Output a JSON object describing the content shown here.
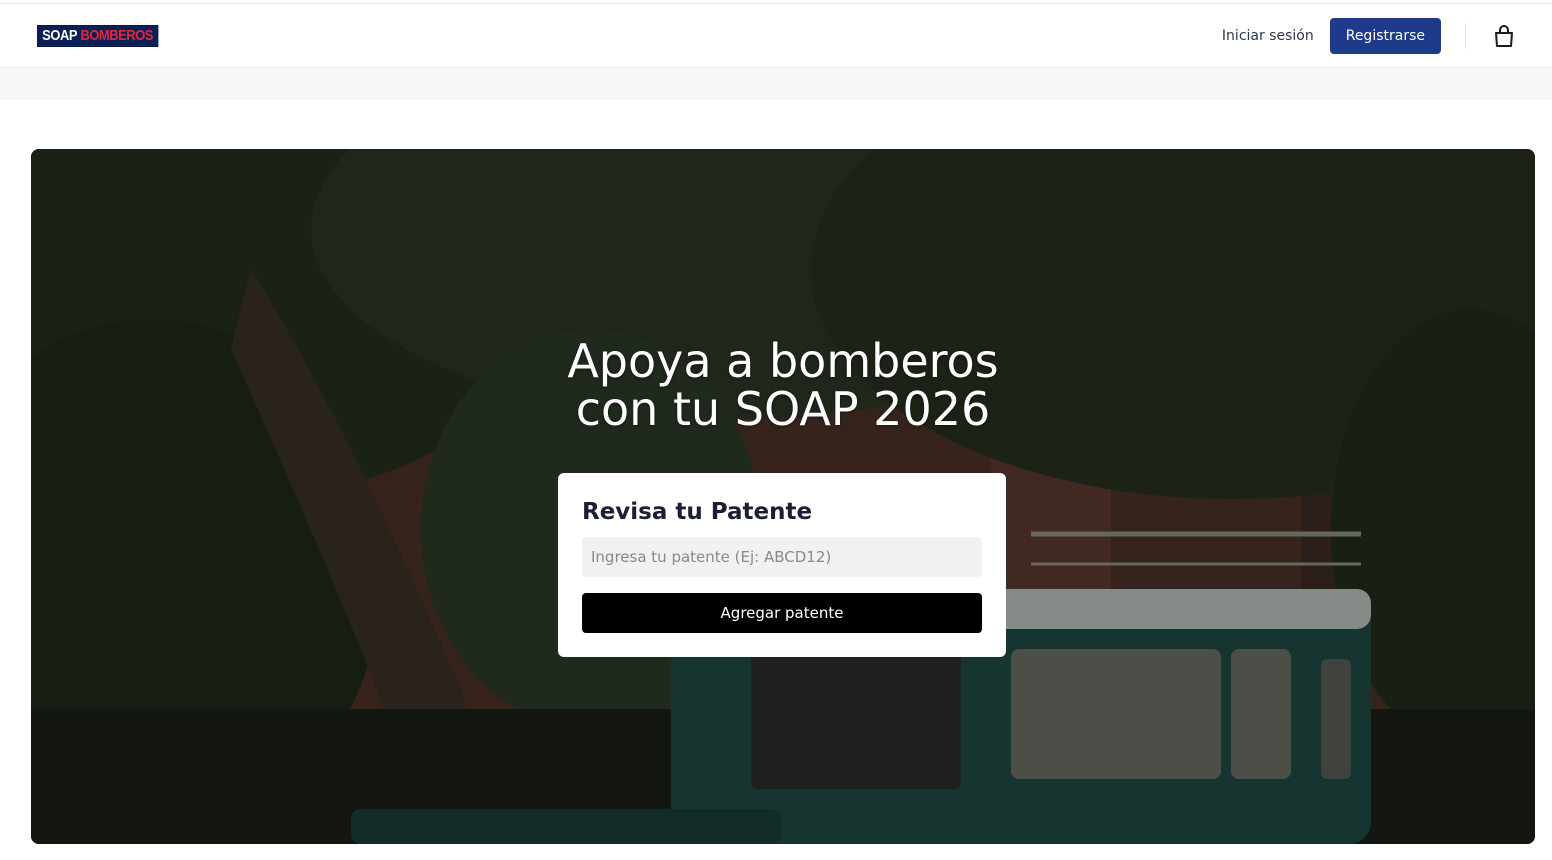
{
  "brand": {
    "logo_part1": "SOAP",
    "logo_part2": "BOMBEROS"
  },
  "header": {
    "login_label": "Iniciar sesión",
    "register_label": "Registrarse",
    "cart_icon": "shopping-bag-icon"
  },
  "hero": {
    "title_line1": "Apoya a bomberos",
    "title_line2": "con tu SOAP 2026"
  },
  "card": {
    "title": "Revisa tu Patente",
    "input_placeholder": "Ingresa tu patente (Ej: ABCD12)",
    "input_value": "",
    "button_label": "Agregar patente"
  },
  "colors": {
    "brand_navy": "#1e3a8a",
    "logo_bg": "#0c1f55",
    "logo_red": "#e3263a",
    "button_black": "#000000"
  }
}
